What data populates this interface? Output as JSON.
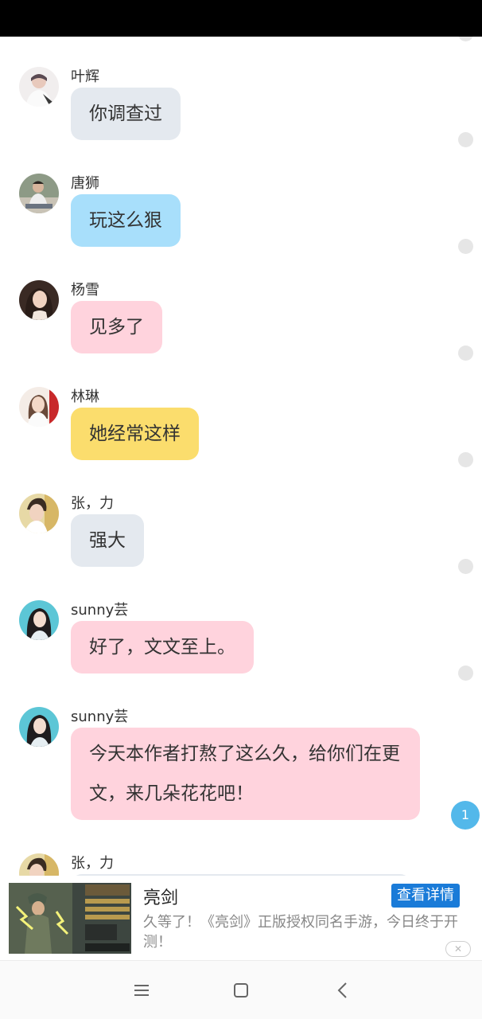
{
  "messages": [
    {
      "name": "叶辉",
      "text": "你调查过",
      "avatar": "avatar-ye-hui"
    },
    {
      "name": "唐狮",
      "text": "玩这么狠",
      "avatar": "avatar-tang-shi"
    },
    {
      "name": "杨雪",
      "text": "见多了",
      "avatar": "avatar-yang-xue"
    },
    {
      "name": "林琳",
      "text": "她经常这样",
      "avatar": "avatar-lin-lin"
    },
    {
      "name": "张，力",
      "text": "强大",
      "avatar": "avatar-zhang-li"
    },
    {
      "name": "sunny芸",
      "text": "好了，文文至上。",
      "avatar": "avatar-sunny-yun"
    },
    {
      "name": "sunny芸",
      "text": "今天本作者打熬了这么久，给你们在更文，来几朵花花吧！",
      "avatar": "avatar-sunny-yun"
    },
    {
      "name": "张，力",
      "text": "",
      "avatar": "avatar-zhang-li"
    }
  ],
  "page_badge": "1",
  "ad": {
    "title": "亮剑",
    "cta": "查看详情",
    "description": "久等了！《亮剑》正版授权同名手游，今日终于开测！",
    "close_icon": "close-icon"
  },
  "nav": {
    "menu_icon": "menu-icon",
    "home_icon": "home-square-icon",
    "back_icon": "back-chevron-icon"
  },
  "colors": {
    "bubble_gray": "#e4e9ef",
    "bubble_blue": "#a8dffb",
    "bubble_pink": "#ffd3dd",
    "bubble_yellow": "#fbdd6d",
    "badge": "#53b8ea",
    "cta": "#1a7bd8"
  }
}
